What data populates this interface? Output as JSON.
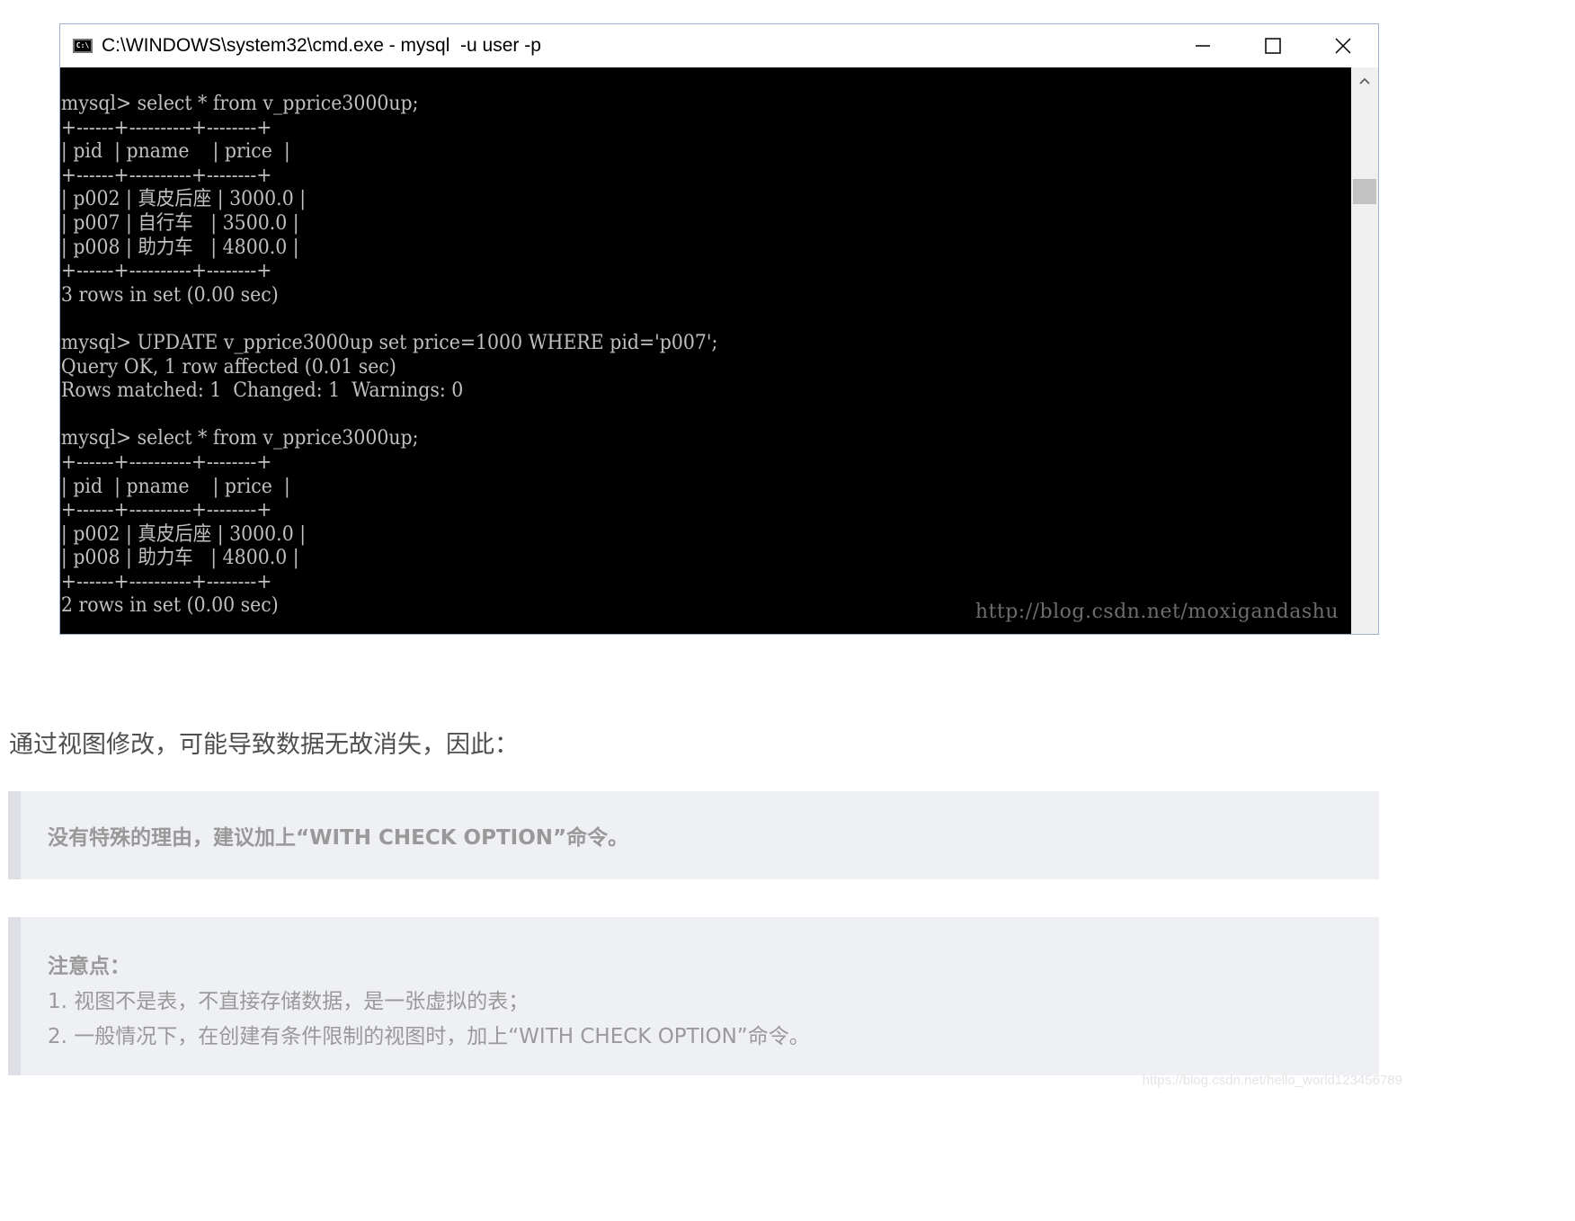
{
  "window": {
    "title": "C:\\WINDOWS\\system32\\cmd.exe - mysql  -u user -p",
    "icon": "cmd-icon",
    "icon_text": "C:\\",
    "controls": [
      "minimize-icon",
      "maximize-icon",
      "close-icon"
    ]
  },
  "console": {
    "lines": [
      "mysql> select * from v_pprice3000up;",
      "+------+----------+--------+",
      "| pid  | pname    | price  |",
      "+------+----------+--------+",
      "| p002 | 真皮后座 | 3000.0 |",
      "| p007 | 自行车   | 3500.0 |",
      "| p008 | 助力车   | 4800.0 |",
      "+------+----------+--------+",
      "3 rows in set (0.00 sec)",
      "",
      "mysql> UPDATE v_pprice3000up set price=1000 WHERE pid='p007';",
      "Query OK, 1 row affected (0.01 sec)",
      "Rows matched: 1  Changed: 1  Warnings: 0",
      "",
      "mysql> select * from v_pprice3000up;",
      "+------+----------+--------+",
      "| pid  | pname    | price  |",
      "+------+----------+--------+",
      "| p002 | 真皮后座 | 3000.0 |",
      "| p008 | 助力车   | 4800.0 |",
      "+------+----------+--------+",
      "2 rows in set (0.00 sec)"
    ],
    "watermark": "http://blog.csdn.net/moxigandashu"
  },
  "article": {
    "paragraph": "通过视图修改，可能导致数据无故消失，因此：",
    "quote1": "没有特殊的理由，建议加上“WITH CHECK OPTION”命令。",
    "quote2": {
      "heading": "注意点：",
      "item1": "1. 视图不是表，不直接存储数据，是一张虚拟的表；",
      "item2": "2. 一般情况下，在创建有条件限制的视图时，加上“WITH CHECK OPTION”命令。"
    }
  },
  "page_watermark": "https://blog.csdn.net/hello_world123456789",
  "colors": {
    "console_bg": "#000000",
    "console_text": "#c0c0c0",
    "quote_bg": "#eef0f4",
    "quote_border": "#dddfe4",
    "quote_text": "#999999"
  }
}
